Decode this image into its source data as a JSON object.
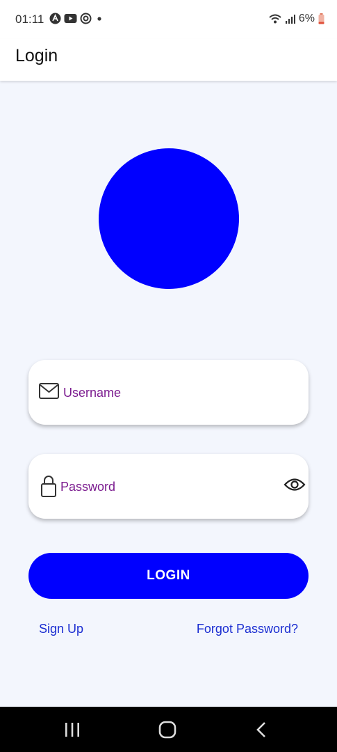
{
  "status_bar": {
    "time": "01:11",
    "battery": "6%",
    "left_icons": [
      "app-notification-icon",
      "youtube-icon",
      "sync-icon",
      "dot-icon"
    ],
    "right_icons": [
      "wifi-icon",
      "signal-icon",
      "battery-icon"
    ]
  },
  "app_bar": {
    "title": "Login"
  },
  "logo": {
    "color": "#0000ff"
  },
  "form": {
    "username_placeholder": "Username",
    "password_placeholder": "Password",
    "login_label": "LOGIN"
  },
  "links": {
    "sign_up": "Sign Up",
    "forgot_password": "Forgot Password?"
  },
  "nav": {
    "icons": [
      "recent-apps-icon",
      "home-icon",
      "back-icon"
    ]
  },
  "colors": {
    "accent": "#0000ff",
    "placeholder": "#7b1b8f",
    "link": "#1a2dd1",
    "background": "#f3f6fd"
  }
}
